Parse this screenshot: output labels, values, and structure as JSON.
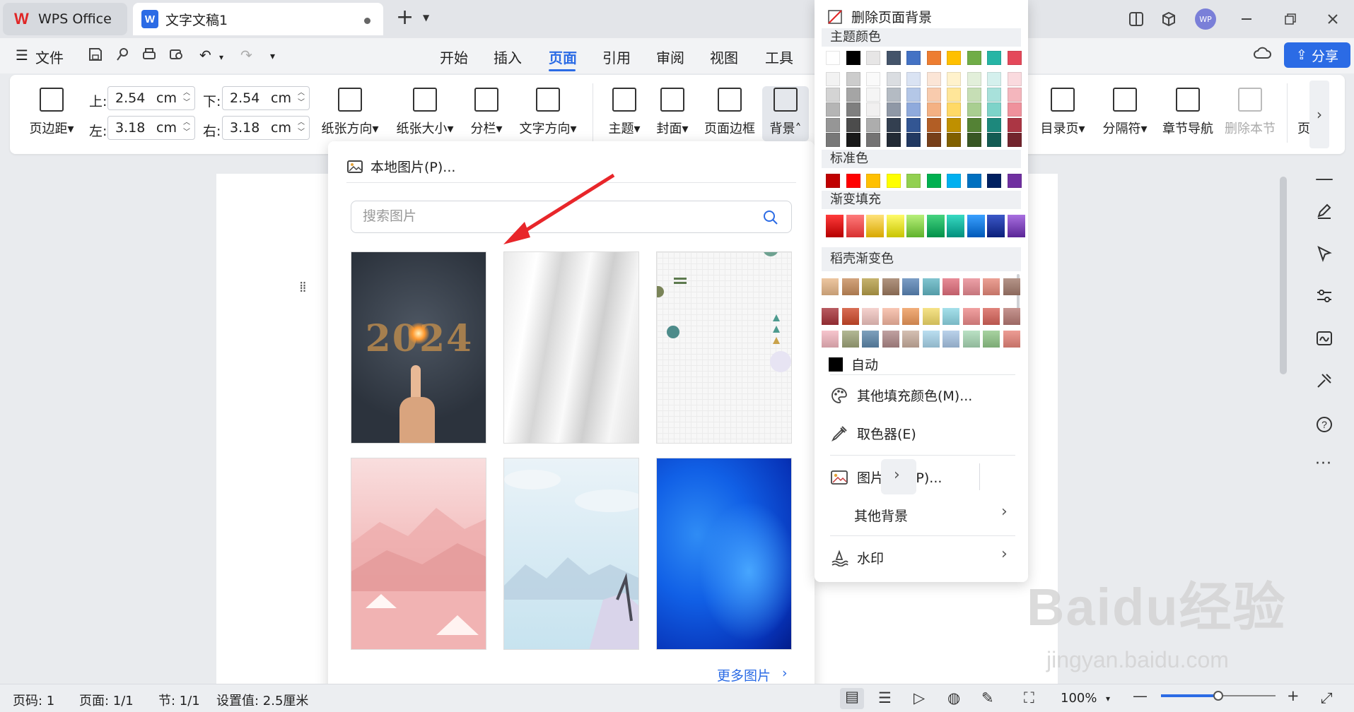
{
  "titlebar": {
    "app_tab": "WPS Office",
    "doc_tab": "文字文稿1",
    "avatar_text": "WP"
  },
  "menu": {
    "file": "文件",
    "items": [
      "开始",
      "插入",
      "页面",
      "引用",
      "审阅",
      "视图",
      "工具"
    ],
    "active": "页面",
    "share": "分享"
  },
  "ribbon": {
    "margins_label": "页边距",
    "top_label": "上:",
    "top_value": "2.54",
    "bottom_label": "下:",
    "bottom_value": "2.54",
    "left_label": "左:",
    "left_value": "3.18",
    "right_label": "右:",
    "right_value": "3.18",
    "unit": "cm",
    "orientation": "纸张方向",
    "size": "纸张大小",
    "columns": "分栏",
    "text_direction": "文字方向",
    "theme": "主题",
    "cover": "封面",
    "page_border": "页面边框",
    "background": "背景",
    "toc_page": "目录页",
    "separator": "分隔符",
    "chapter_nav": "章节导航",
    "delete_section": "删除本节",
    "page_partial": "页"
  },
  "picture_popup": {
    "local_picture": "本地图片(P)...",
    "search_placeholder": "搜索图片",
    "more_pictures": "更多图片",
    "thumbs": [
      "2024",
      "",
      "",
      "",
      "",
      ""
    ]
  },
  "color_panel": {
    "delete_bg": "删除页面背景",
    "theme_colors": "主题颜色",
    "standard_colors": "标准色",
    "gradient_fill": "渐变填充",
    "docer_gradient": "稻壳渐变色",
    "auto": "自动",
    "more_fill": "其他填充颜色(M)...",
    "eyedropper": "取色器(E)",
    "picture_bg": "图片背景(P)...",
    "other_bg": "其他背景",
    "watermark": "水印",
    "theme_top": [
      "#ffffff",
      "#000000",
      "#e7e6e6",
      "#44546a",
      "#4472c4",
      "#ed7d31",
      "#ffc000",
      "#70ad47",
      "#26b5a5",
      "#e4485a"
    ],
    "standard": [
      "#c00000",
      "#ff0000",
      "#ffc000",
      "#ffff00",
      "#92d050",
      "#00b050",
      "#00b0f0",
      "#0070c0",
      "#002060",
      "#7030a0"
    ]
  },
  "status": {
    "page_num": "页码: 1",
    "page": "页面: 1/1",
    "section": "节: 1/1",
    "setting": "设置值: 2.5厘米",
    "zoom": "100%"
  },
  "watermark": {
    "brand": "Baidu经验",
    "url": "jingyan.baidu.com"
  }
}
